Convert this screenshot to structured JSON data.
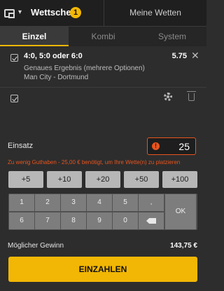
{
  "header": {
    "betslip_label": "Wettschein",
    "betslip_count": "1",
    "my_bets_label": "Meine Wetten"
  },
  "modes": [
    "Einzel",
    "Kombi",
    "System"
  ],
  "bet": {
    "selection": "4:0, 5:0 oder 6:0",
    "odds": "5.75",
    "market": "Genaues Ergebnis (mehrere Optionen)",
    "event": "Man City - Dortmund"
  },
  "stake": {
    "label": "Einsatz",
    "value": "25",
    "warning_icon": "!",
    "error": "Zu wenig Guthaben - 25,00 € benötigt, um Ihre Wette(n) zu platzieren"
  },
  "quick_amounts": [
    "+5",
    "+10",
    "+20",
    "+50",
    "+100"
  ],
  "keypad": {
    "row1": [
      "1",
      "2",
      "3",
      "4",
      "5",
      ","
    ],
    "row2": [
      "6",
      "7",
      "8",
      "9",
      "0"
    ],
    "ok": "OK"
  },
  "potential_win": {
    "label": "Möglicher Gewinn",
    "value": "143,75 €"
  },
  "deposit_label": "EINZAHLEN",
  "icons": [
    "wallet-icon",
    "chevron-down-icon",
    "checkbox-icon",
    "close-icon",
    "gear-icon",
    "trash-icon",
    "warning-icon",
    "backspace-icon"
  ],
  "colors": {
    "accent": "#f2b705",
    "error": "#e8541e",
    "background": "#2d2d2d"
  }
}
